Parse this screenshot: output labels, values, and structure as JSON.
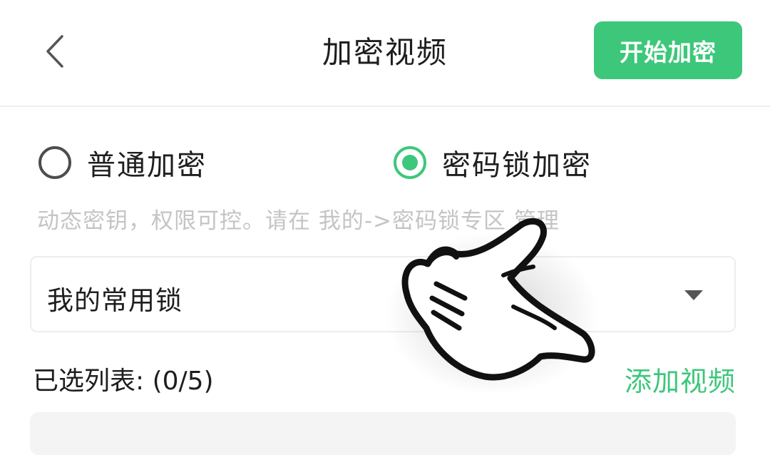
{
  "header": {
    "title": "加密视频",
    "back_icon": "chevron-left-icon",
    "start_button": "开始加密"
  },
  "encryption_mode": {
    "options": [
      {
        "label": "普通加密",
        "selected": false
      },
      {
        "label": "密码锁加密",
        "selected": true
      }
    ],
    "hint": "动态密钥，权限可控。请在 我的->密码锁专区 管理"
  },
  "lock_select": {
    "value": "我的常用锁",
    "icon": "caret-down-icon"
  },
  "selected_list": {
    "label": "已选列表: (0/5)",
    "add_button": "添加视频"
  },
  "colors": {
    "accent": "#3dc77b",
    "hint_text": "#c4c4c4"
  },
  "overlay": {
    "icon": "pointing-hand-icon"
  }
}
